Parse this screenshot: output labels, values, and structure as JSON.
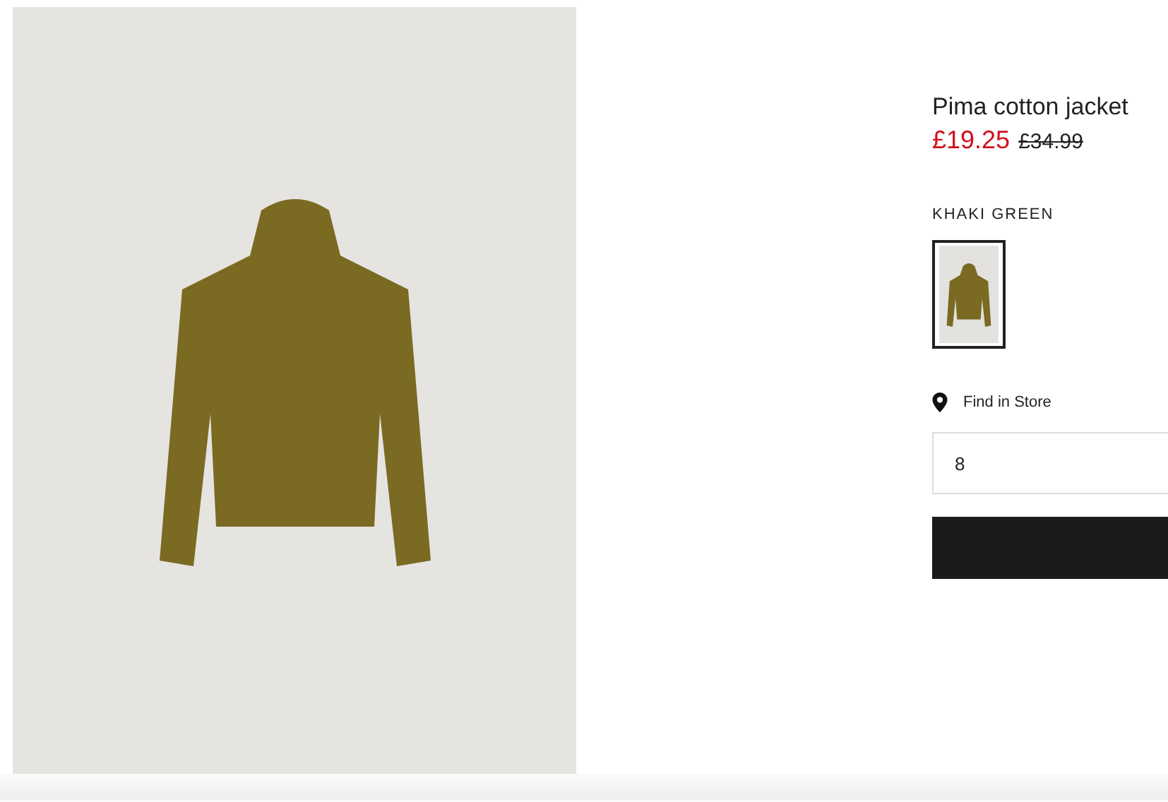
{
  "product": {
    "title": "Pima cotton jacket",
    "price": "£19.25",
    "old_price": "£34.99"
  },
  "color": {
    "name": "KHAKI GREEN",
    "swatches": [
      {
        "selected": true
      }
    ]
  },
  "find_in_store": "Find in Store",
  "size_field": {
    "value": "8"
  }
}
